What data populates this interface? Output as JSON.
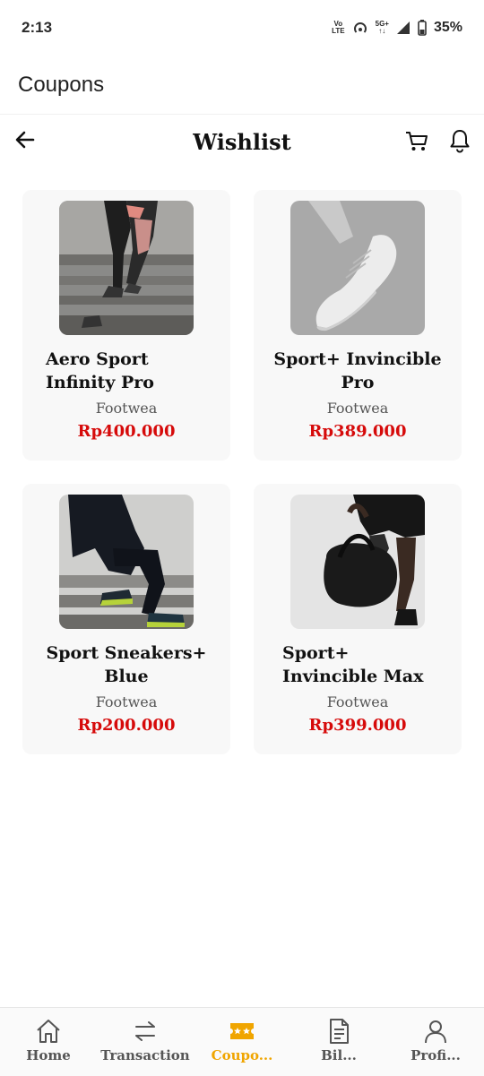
{
  "status_bar": {
    "time": "2:13",
    "net_top": "Vo",
    "net_bottom": "LTE",
    "signal_top": "5G+",
    "battery": "35%"
  },
  "app_bar": {
    "title": "Coupons"
  },
  "header": {
    "title": "Wishlist"
  },
  "products": [
    {
      "name": "Aero Sport Infinity Pro",
      "category": "Footwea",
      "price": "Rp400.000"
    },
    {
      "name": "Sport+ Invincible Pro",
      "category": "Footwea",
      "price": "Rp389.000"
    },
    {
      "name": "Sport Sneakers+ Blue",
      "category": "Footwea",
      "price": "Rp200.000"
    },
    {
      "name": "Sport+ Invincible Max",
      "category": "Footwea",
      "price": "Rp399.000"
    }
  ],
  "bottom_nav": [
    {
      "label": "Home",
      "icon": "home-icon"
    },
    {
      "label": "Transaction",
      "icon": "swap-icon"
    },
    {
      "label": "Coupo...",
      "icon": "coupon-icon",
      "active": true
    },
    {
      "label": "Bil...",
      "icon": "bill-icon"
    },
    {
      "label": "Profi...",
      "icon": "profile-icon"
    }
  ],
  "colors": {
    "accent": "#f0a500",
    "price": "#d60a0a",
    "card_bg": "#f8f8f8"
  }
}
